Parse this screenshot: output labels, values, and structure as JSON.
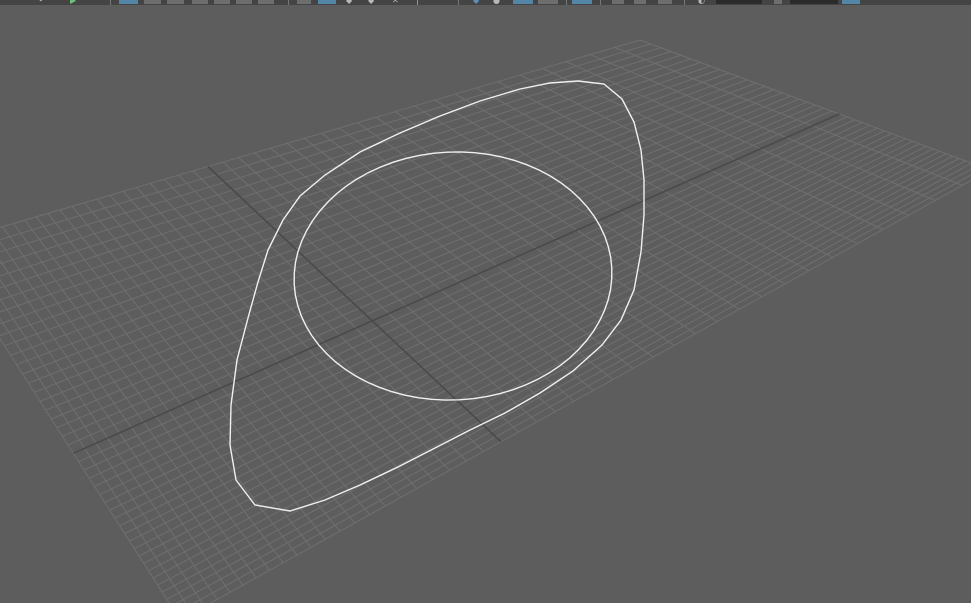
{
  "viewport": {
    "background_color": "#5d5d5d",
    "grid_line_color": "#6f6f6f",
    "grid_axis_color": "#4a4a4a",
    "curve_color": "#f0f0f0"
  },
  "toolbar": {
    "background_color": "#444444",
    "active_color": "#5285a6"
  }
}
